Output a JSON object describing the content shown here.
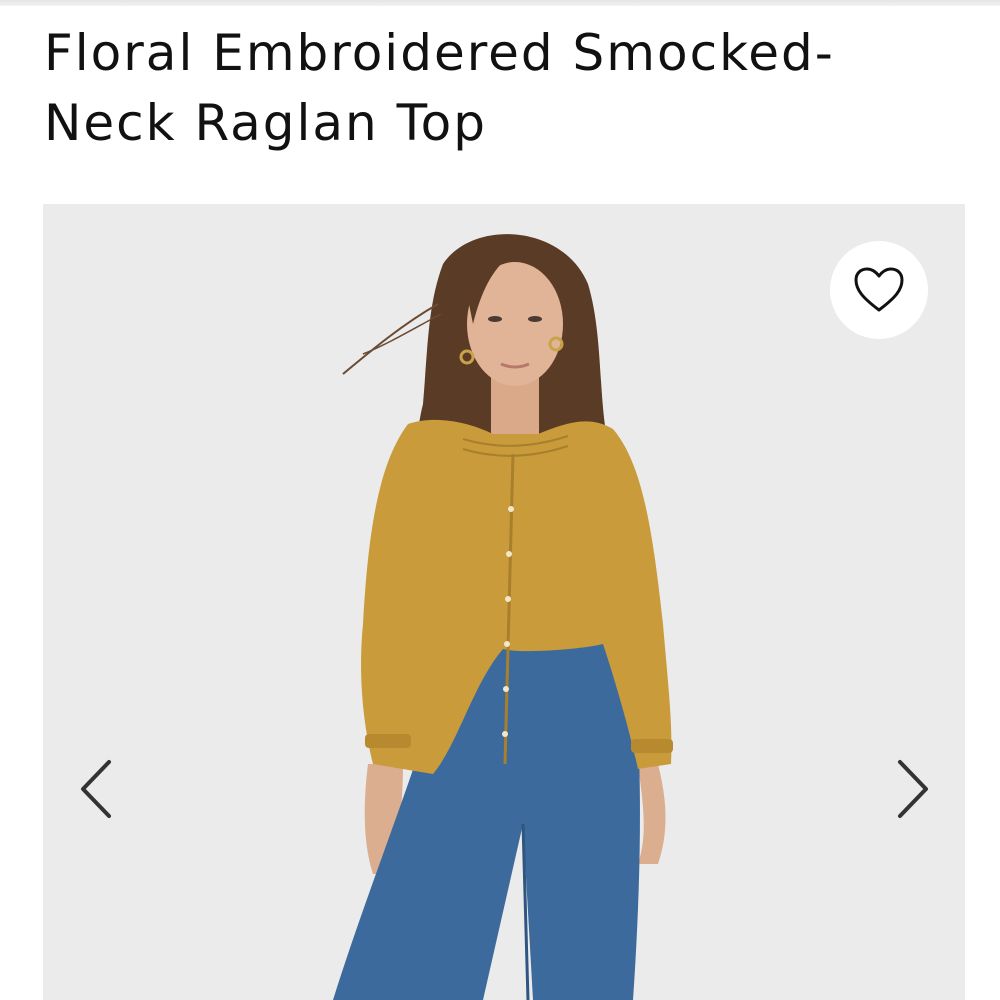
{
  "product": {
    "title_line1": "Floral Embroidered Smocked-",
    "title_line2": "Neck Raglan Top"
  },
  "gallery": {
    "background_color": "#ebebeb",
    "icons": {
      "favorite": "heart-outline-icon",
      "previous": "chevron-left-icon",
      "next": "chevron-right-icon"
    }
  },
  "colors": {
    "top": "#c99b3a",
    "jeans": "#3d6a9c",
    "hair": "#5a3b26"
  }
}
